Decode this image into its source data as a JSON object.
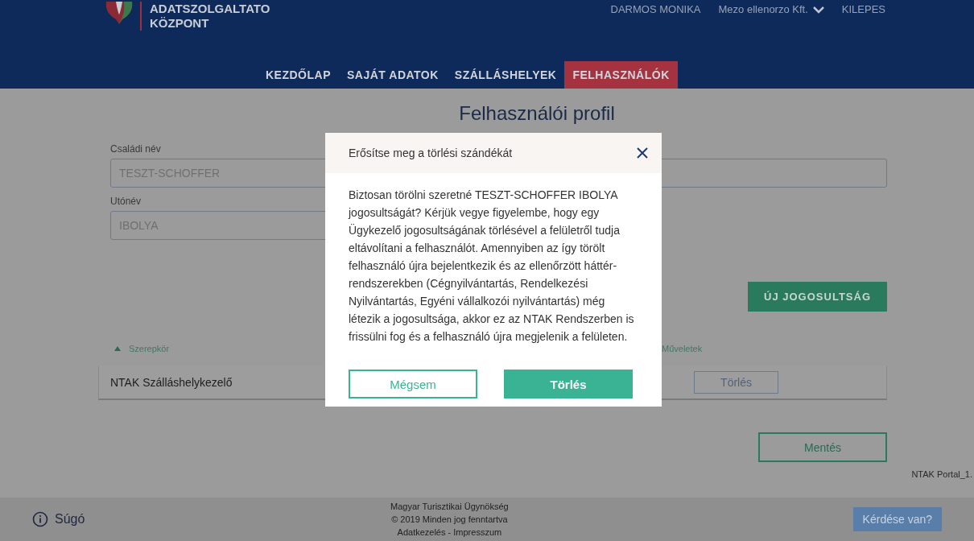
{
  "header": {
    "logo_lines": [
      "ADATSZOLGALTATO",
      "KÖZPONT"
    ],
    "user": "DARMOS MONIKA",
    "company": "Mezo ellenorzo Kft.",
    "logout": "KILEPES",
    "nav": [
      {
        "label": "KEZDŐLAP",
        "selected": false
      },
      {
        "label": "SAJÁT ADATOK",
        "selected": false
      },
      {
        "label": "SZÁLLÁSHELYEK",
        "selected": false
      },
      {
        "label": "FELHASZNÁLÓK",
        "selected": true
      }
    ]
  },
  "page_title": "Felhasználói profil",
  "fields": [
    {
      "label": "Családi név",
      "value": "TESZT-SCHOFFER"
    },
    {
      "label": "Utónév",
      "value": "IBOLYA"
    }
  ],
  "new_button": "ÚJ JOGOSULTSÁG",
  "table": {
    "columns": [
      {
        "label": "Szerepkör",
        "sorted": true
      },
      {
        "label": "Műveletek",
        "sorted": false
      }
    ],
    "rows": [
      {
        "role": "NTAK Szálláshelykezelő",
        "action": "Törlés"
      }
    ]
  },
  "save_button": "Mentés",
  "version": "NTAK Portal_1.",
  "footer": {
    "help": "Súgó",
    "lines": [
      "Magyar Turisztikai Ügynökség",
      "© 2019 Minden jog fenntartva",
      "Adatkezelés - Impresszum"
    ],
    "question_button": "Kérdése van?"
  },
  "modal": {
    "title": "Erősítse meg a törlési szándékát",
    "body": "Biztosan törölni szeretné TESZT-SCHOFFER IBOLYA jogosultságát? Kérjük vegye figyelembe, hogy egy Ügykezelő jogosultságának törlésével a felületről tudja eltávolítani a felhasználót. Amennyiben az így törölt felhasználó újra bejelentkezik és az ellenőrzött háttér-rendszerekben (Cégnyilvántartás, Rendelkezési Nyilvántartás, Egyéni vállalkozói nyilvántartás) még létezik a jogosultsága, akkor ez az NTAK Rendszerben is frissülni fog és a felhasználó újra megjelenik a felületen.",
    "cancel": "Mégsem",
    "confirm": "Törlés"
  }
}
